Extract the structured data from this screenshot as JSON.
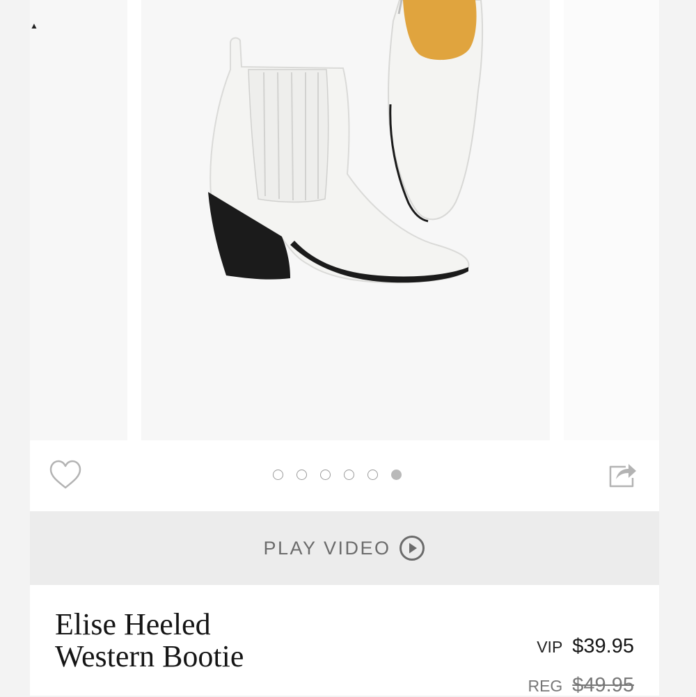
{
  "carousel": {
    "image_alt": "White heeled western bootie",
    "dots": [
      {
        "active": false
      },
      {
        "active": false
      },
      {
        "active": false
      },
      {
        "active": false
      },
      {
        "active": false
      },
      {
        "active": true
      }
    ]
  },
  "actions": {
    "wishlist_icon": "heart-outline-icon",
    "share_icon": "share-icon"
  },
  "video": {
    "label": "PLAY VIDEO",
    "icon": "play-circle-icon"
  },
  "product": {
    "title_line1": "Elise Heeled",
    "title_line2": "Western Bootie",
    "vip_label": "VIP",
    "vip_price": "$39.95",
    "reg_label": "REG",
    "reg_price": "$49.95"
  },
  "colors": {
    "boot_white": "#f4f4f2",
    "heel_black": "#1b1b1b",
    "lining_tan": "#e0a43e"
  }
}
